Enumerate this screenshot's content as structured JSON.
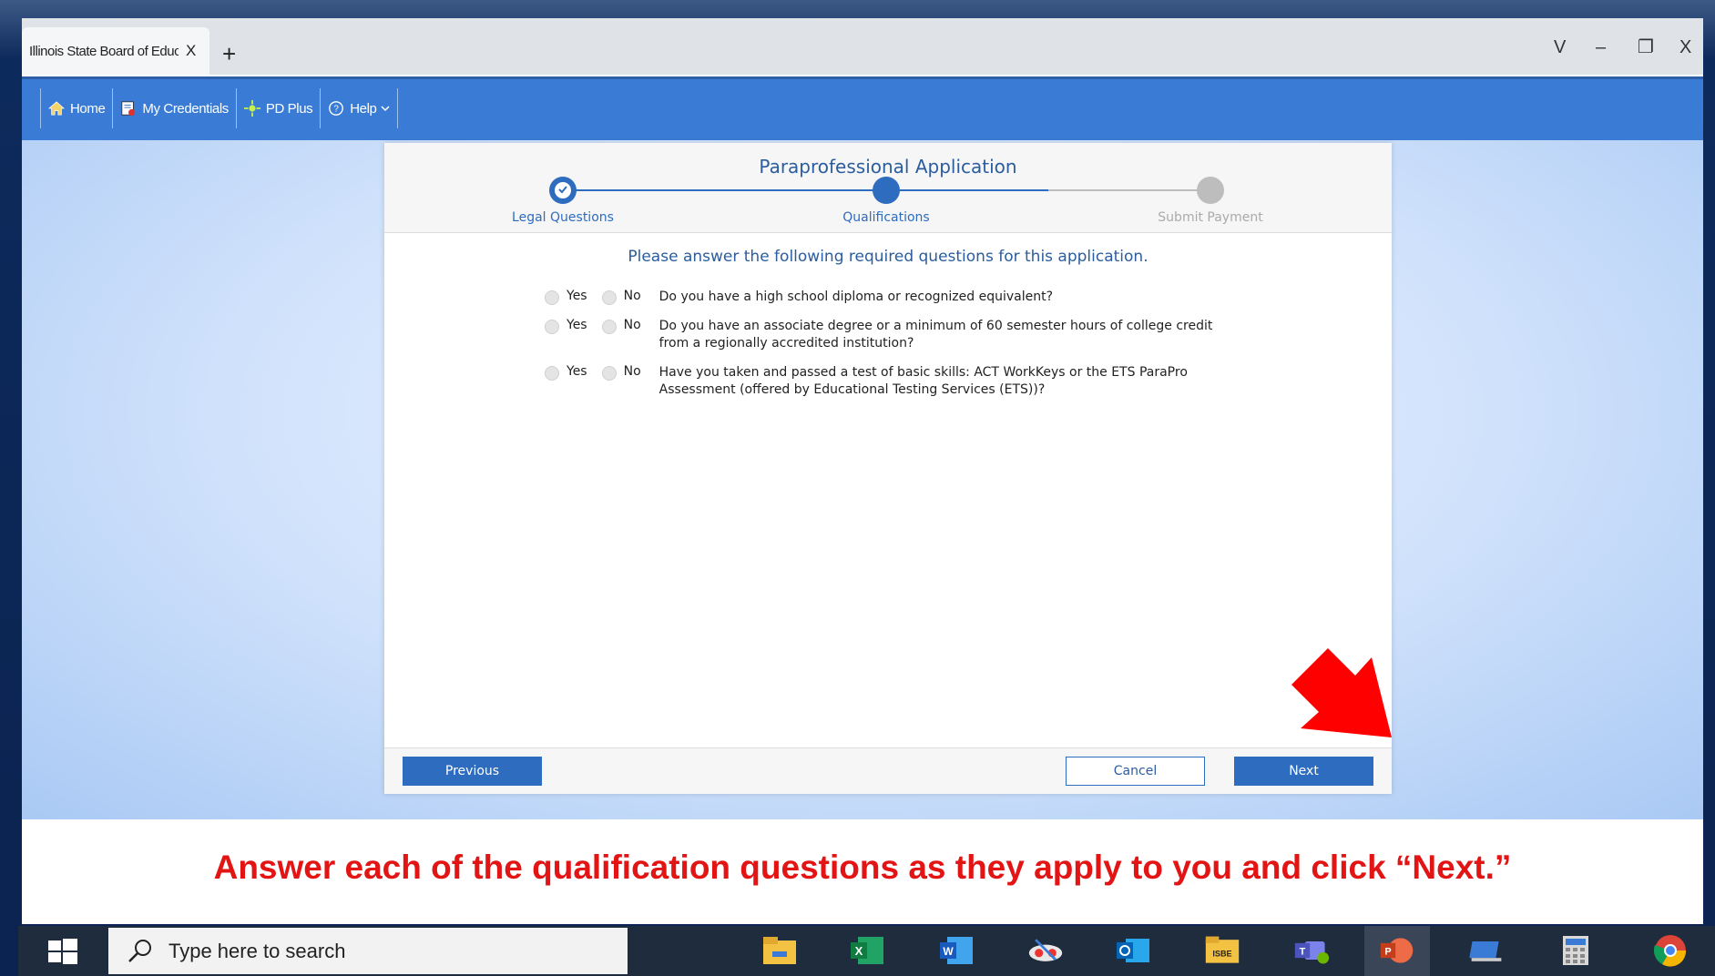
{
  "browser": {
    "tab_title": "Illinois State Board of Education",
    "tab_close": "X",
    "new_tab": "+",
    "window_controls": {
      "chevron": "V",
      "minimize": "–",
      "restore": "❐",
      "close": "X"
    }
  },
  "nav": {
    "items": [
      {
        "label": "Home",
        "icon": "home-icon"
      },
      {
        "label": "My Credentials",
        "icon": "credentials-icon"
      },
      {
        "label": "PD Plus",
        "icon": "pd-plus-icon"
      },
      {
        "label": "Help",
        "icon": "help-icon",
        "has_dropdown": true
      }
    ]
  },
  "application": {
    "title": "Paraprofessional Application",
    "steps": [
      {
        "label": "Legal Questions",
        "state": "complete"
      },
      {
        "label": "Qualifications",
        "state": "current"
      },
      {
        "label": "Submit Payment",
        "state": "pending"
      }
    ],
    "instructions": "Please answer the following required questions for this application.",
    "option_yes": "Yes",
    "option_no": "No",
    "questions": [
      {
        "text": "Do you have a high school diploma or recognized equivalent?"
      },
      {
        "text": "Do you have an associate degree or a minimum of 60 semester hours of college credit from a regionally accredited institution?"
      },
      {
        "text": "Have you taken and passed a test of basic skills: ACT WorkKeys or the ETS ParaPro Assessment (offered by Educational Testing Services (ETS))?"
      }
    ],
    "buttons": {
      "previous": "Previous",
      "cancel": "Cancel",
      "next": "Next"
    }
  },
  "caption": "Answer each of the qualification questions as they apply to you and click “Next.”",
  "taskbar": {
    "search_placeholder": "Type here to search",
    "apps": [
      "file-explorer",
      "excel",
      "word",
      "snipping-tool",
      "outlook",
      "isbe",
      "teams",
      "powerpoint",
      "remote-desktop",
      "calculator",
      "chrome"
    ],
    "isbe_label": "ISBE"
  },
  "colors": {
    "accent": "#2e6cc0",
    "navbar": "#3a7bd5",
    "caption": "#e31414"
  }
}
